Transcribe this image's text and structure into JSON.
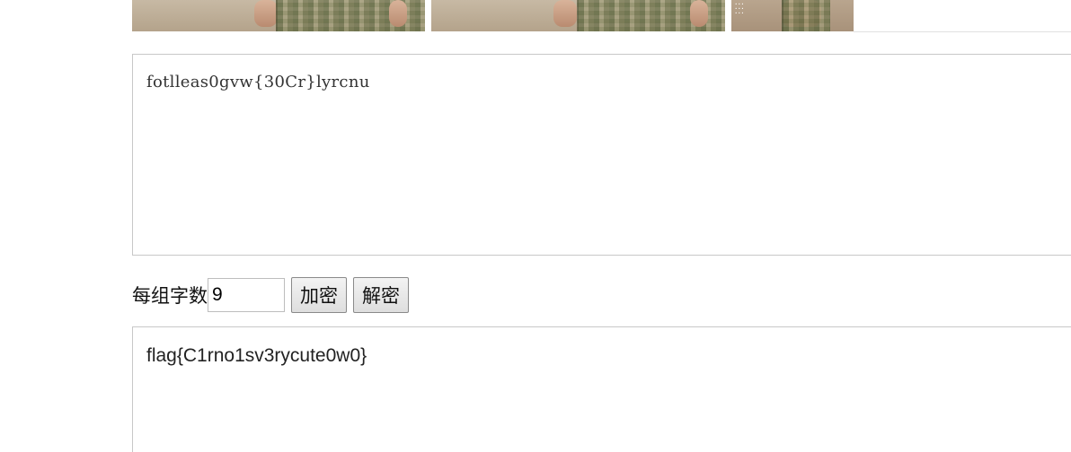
{
  "images": [
    {
      "name": "camo-photo-1"
    },
    {
      "name": "camo-photo-2"
    },
    {
      "name": "camo-photo-3"
    }
  ],
  "cipher_text": "fotlleas0gvw{30Cr}lyrcnu",
  "controls": {
    "group_size_label": "每组字数",
    "group_size_value": "9",
    "encrypt_label": "加密",
    "decrypt_label": "解密"
  },
  "plain_text": "flag{C1rno1sv3rycute0w0}"
}
